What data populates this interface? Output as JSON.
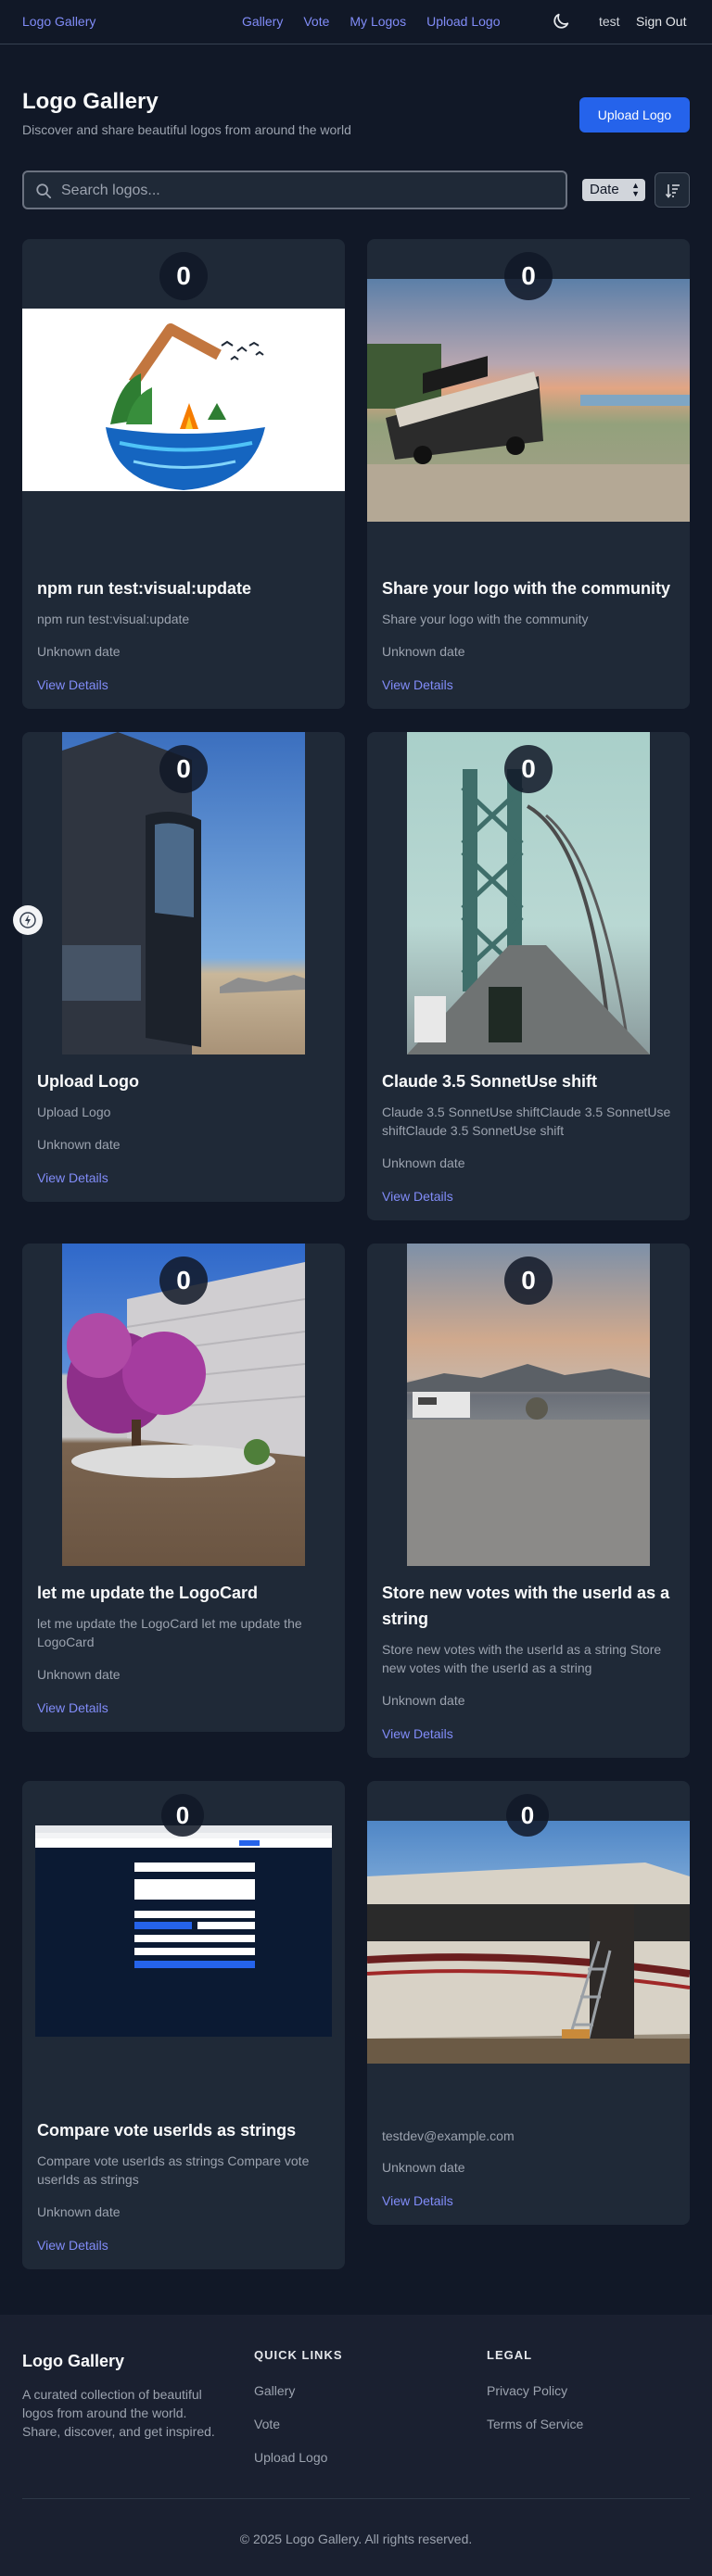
{
  "nav": {
    "brand": "Logo Gallery",
    "links": [
      "Gallery",
      "Vote",
      "My Logos",
      "Upload Logo"
    ],
    "theme_icon": "moon-icon",
    "user": "test",
    "signout": "Sign Out"
  },
  "hero": {
    "title": "Logo Gallery",
    "subtitle": "Discover and share beautiful logos from around the world",
    "upload_label": "Upload Logo"
  },
  "search": {
    "placeholder": "Search logos...",
    "value": "",
    "sort_value": "Date"
  },
  "cards": [
    {
      "votes": "0",
      "title": "npm run test:visual:update",
      "desc": "npm run test:visual:update",
      "date": "Unknown date",
      "details": "View Details"
    },
    {
      "votes": "0",
      "title": "Share your logo with the community",
      "desc": "Share your logo with the community",
      "date": "Unknown date",
      "details": "View Details"
    },
    {
      "votes": "0",
      "title": "Upload Logo",
      "desc": "Upload Logo",
      "date": "Unknown date",
      "details": "View Details"
    },
    {
      "votes": "0",
      "title": "Claude 3.5 SonnetUse shift",
      "desc": "Claude 3.5 SonnetUse shiftClaude 3.5 SonnetUse shiftClaude 3.5 SonnetUse shift",
      "date": "Unknown date",
      "details": "View Details"
    },
    {
      "votes": "0",
      "title": "let me update the LogoCard",
      "desc": "let me update the LogoCard let me update the LogoCard",
      "date": "Unknown date",
      "details": "View Details"
    },
    {
      "votes": "0",
      "title": "Store new votes with the userId as a string",
      "desc": "Store new votes with the userId as a string Store new votes with the userId as a string",
      "date": "Unknown date",
      "details": "View Details"
    },
    {
      "votes": "0",
      "title": "Compare vote userIds as strings",
      "desc": "Compare vote userIds as strings Compare vote userIds as strings",
      "date": "Unknown date",
      "details": "View Details"
    },
    {
      "votes": "0",
      "title": "",
      "desc": "testdev@example.com",
      "date": "Unknown date",
      "details": "View Details"
    }
  ],
  "footer": {
    "brand": "Logo Gallery",
    "text": "A curated collection of beautiful logos from around the world. Share, discover, and get inspired.",
    "quick_links_heading": "QUICK LINKS",
    "quick_links": [
      "Gallery",
      "Vote",
      "Upload Logo"
    ],
    "legal_heading": "LEGAL",
    "legal_links": [
      "Privacy Policy",
      "Terms of Service"
    ],
    "copyright": "© 2025 Logo Gallery. All rights reserved."
  },
  "colors": {
    "accent": "#818cf8",
    "primary_button": "#2563eb",
    "background": "#111827",
    "card": "#1f2937"
  }
}
